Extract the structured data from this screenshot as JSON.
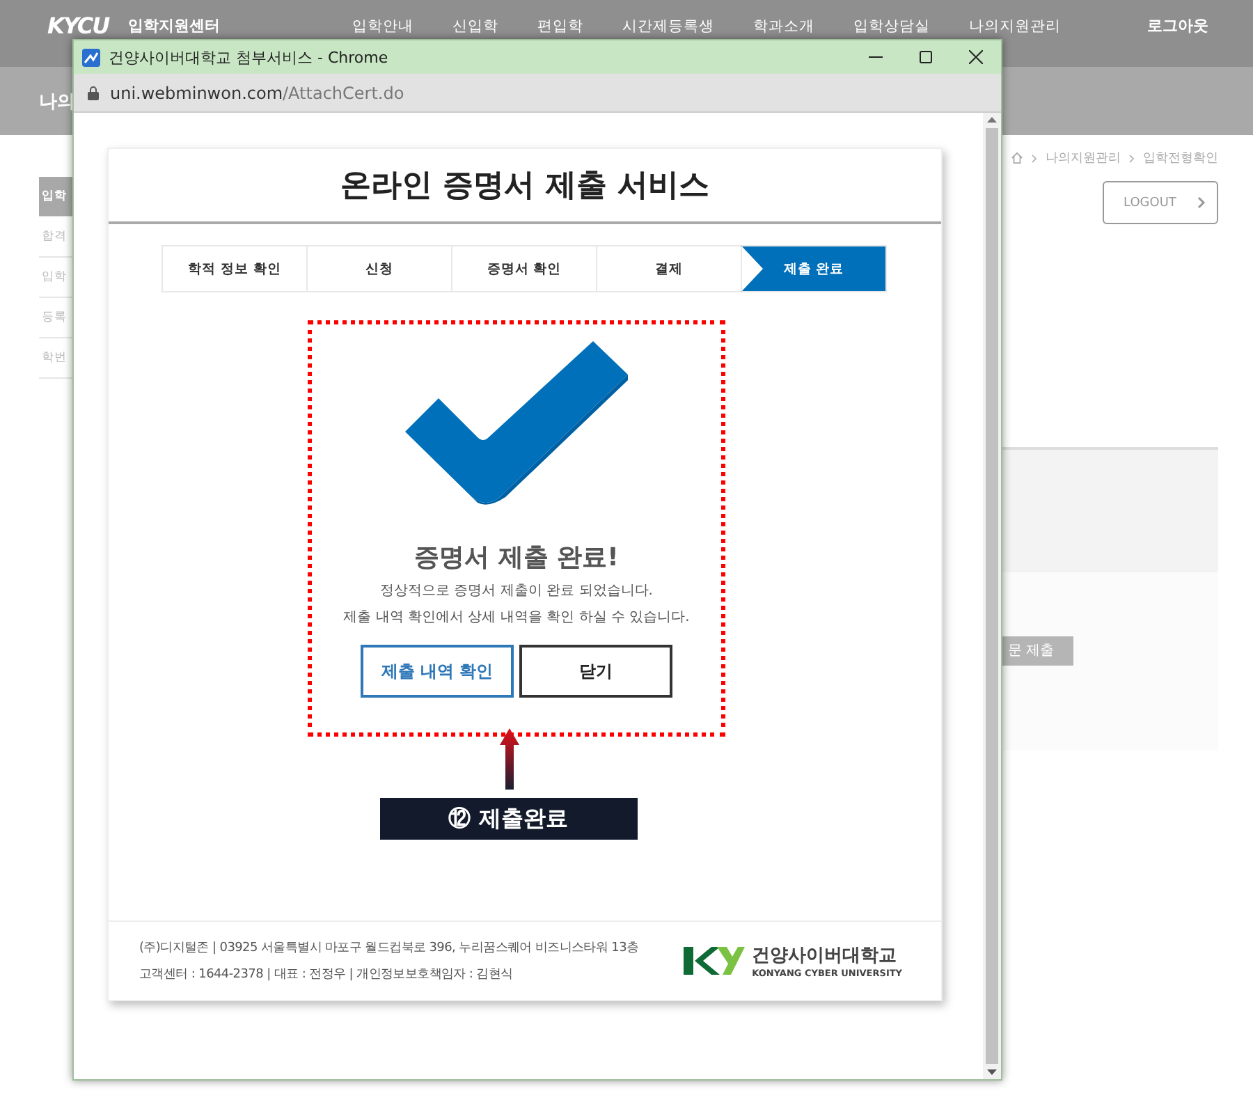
{
  "site": {
    "logo": "KYCU",
    "title": "입학지원센터",
    "nav": [
      "입학안내",
      "신입학",
      "편입학",
      "시간제등록생",
      "학과소개",
      "입학상담실",
      "나의지원관리"
    ],
    "logout_link": "로그아웃",
    "page_title": "나의",
    "sidebar": [
      {
        "label": "입학",
        "selected": true
      },
      {
        "label": "합격",
        "selected": false
      },
      {
        "label": "입학",
        "selected": false
      },
      {
        "label": "등록",
        "selected": false
      },
      {
        "label": "학번",
        "selected": false
      }
    ],
    "breadcrumb": [
      "나의지원관리",
      "입학전형확인"
    ],
    "logout_button": "LOGOUT",
    "panel_button": "문 제출"
  },
  "popup": {
    "title": "건양사이버대학교 첨부서비스 - Chrome",
    "url_host": "uni.webminwon.com",
    "url_path": "/AttachCert.do",
    "heading": "온라인 증명서 제출 서비스",
    "steps": [
      {
        "label": "학적 정보 확인",
        "selected": false
      },
      {
        "label": "신청",
        "selected": false
      },
      {
        "label": "증명서 확인",
        "selected": false
      },
      {
        "label": "결제",
        "selected": false
      },
      {
        "label": "제출 완료",
        "selected": true
      }
    ],
    "result_title": "증명서 제출 완료!",
    "result_lines": [
      "정상적으로 증명서 제출이 완료 되었습니다.",
      "제출 내역 확인에서 상세 내역을 확인 하실 수 있습니다."
    ],
    "buttons": [
      {
        "label": "제출 내역 확인",
        "kind": "primary"
      },
      {
        "label": "닫기",
        "kind": "secondary"
      }
    ],
    "annotation": "⑫ 제출완료",
    "footer_lines": [
      "(주)디지털존 | 03925 서울특별시 마포구 월드컵북로 396, 누리꿈스퀘어 비즈니스타워 13층",
      "고객센터 : 1644-2378 | 대표 : 전정우 | 개인정보보호책임자 : 김현식"
    ],
    "footer_logo": {
      "name": "건양사이버대학교",
      "english": "KONYANG CYBER UNIVERSITY"
    }
  }
}
